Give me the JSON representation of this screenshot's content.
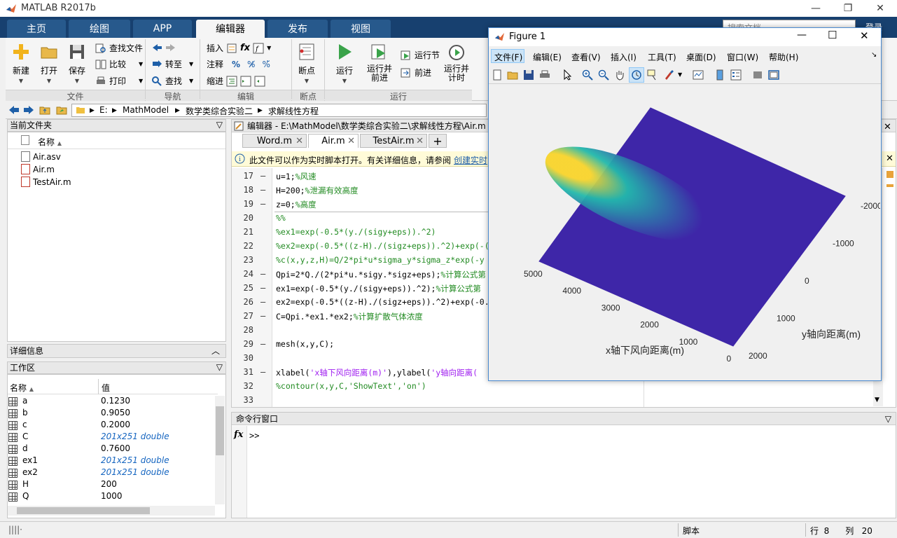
{
  "app": {
    "title": "MATLAB R2017b"
  },
  "ribbon_tabs": [
    "主页",
    "绘图",
    "APP",
    "编辑器",
    "发布",
    "视图"
  ],
  "ribbon": {
    "new": "新建",
    "open": "打开",
    "save": "保存",
    "find_files": "查找文件",
    "compare": "比较",
    "print": "打印",
    "goto": "转至",
    "find": "查找",
    "insert": "插入",
    "comment": "注释",
    "indent": "缩进",
    "breakpoints": "断点",
    "run": "运行",
    "run_advance": "运行并\n前进",
    "run_section": "运行节",
    "advance": "前进",
    "run_time": "运行并\n计时",
    "groups": {
      "file": "文件",
      "navigate": "导航",
      "edit": "编辑",
      "breakpoints": "断点",
      "run": "运行"
    }
  },
  "search": {
    "placeholder": "搜索文档",
    "user": "登录"
  },
  "address": {
    "drive": "E:",
    "p1": "MathModel",
    "p2": "数学类综合实验二",
    "p3": "求解线性方程"
  },
  "current_folder": {
    "title": "当前文件夹",
    "column": "名称",
    "files": [
      "Air.asv",
      "Air.m",
      "TestAir.m"
    ]
  },
  "details": {
    "title": "详细信息"
  },
  "workspace": {
    "title": "工作区",
    "col_name": "名称",
    "col_value": "值",
    "rows": [
      {
        "name": "a",
        "value": "0.1230",
        "link": false
      },
      {
        "name": "b",
        "value": "0.9050",
        "link": false
      },
      {
        "name": "c",
        "value": "0.2000",
        "link": false
      },
      {
        "name": "C",
        "value": "201x251 double",
        "link": true
      },
      {
        "name": "d",
        "value": "0.7600",
        "link": false
      },
      {
        "name": "ex1",
        "value": "201x251 double",
        "link": true
      },
      {
        "name": "ex2",
        "value": "201x251 double",
        "link": true
      },
      {
        "name": "H",
        "value": "200",
        "link": false
      },
      {
        "name": "Q",
        "value": "1000",
        "link": false
      }
    ]
  },
  "editor": {
    "title": "编辑器 - E:\\MathModel\\数学类综合实验二\\求解线性方程\\Air.m",
    "tabs": [
      "Word.m",
      "Air.m",
      "TestAir.m"
    ],
    "info": "此文件可以作为实时脚本打开。有关详细信息，请参阅",
    "info_link": "创建实时",
    "lines": [
      {
        "n": "17",
        "dash": "—",
        "code": "u=1;",
        "comment": "%风速"
      },
      {
        "n": "18",
        "dash": "—",
        "code": "H=200;",
        "comment": "%泄漏有效高度"
      },
      {
        "n": "19",
        "dash": "—",
        "code": "z=0;",
        "comment": "%高度"
      },
      {
        "n": "20",
        "dash": "",
        "code": "",
        "comment": "%%"
      },
      {
        "n": "21",
        "dash": "",
        "code": "",
        "comment": "%ex1=exp(-0.5*(y./(sigy+eps)).^2)"
      },
      {
        "n": "22",
        "dash": "",
        "code": "",
        "comment": "%ex2=exp(-0.5*((z-H)./(sigz+eps)).^2)+exp(-("
      },
      {
        "n": "23",
        "dash": "",
        "code": "",
        "comment": "%c(x,y,z,H)=Q/2*pi*u*sigma_y*sigma_z*exp(-y"
      },
      {
        "n": "24",
        "dash": "—",
        "code": "Qpi=2*Q./(2*pi*u.*sigy.*sigz+eps);",
        "comment": "%计算公式第"
      },
      {
        "n": "25",
        "dash": "—",
        "code": "ex1=exp(-0.5*(y./(sigy+eps)).^2);",
        "comment": "%计算公式第"
      },
      {
        "n": "26",
        "dash": "—",
        "code": "ex2=exp(-0.5*((z-H)./(sigz+eps)).^2)+exp(-0.",
        "comment": ""
      },
      {
        "n": "27",
        "dash": "—",
        "code": "C=Qpi.*ex1.*ex2;",
        "comment": "%计算扩散气体浓度"
      },
      {
        "n": "28",
        "dash": "",
        "code": "",
        "comment": ""
      },
      {
        "n": "29",
        "dash": "—",
        "code": "mesh(x,y,C);",
        "comment": ""
      },
      {
        "n": "30",
        "dash": "",
        "code": "",
        "comment": ""
      },
      {
        "n": "31",
        "dash": "—",
        "code": "xlabel(",
        "str1": "'x轴下风向距离(m)'",
        "mid": "),ylabel(",
        "str2": "'y轴向距离(",
        "comment": ""
      },
      {
        "n": "32",
        "dash": "",
        "code": "",
        "comment": "%contour(x,y,C,'ShowText','on')"
      },
      {
        "n": "33",
        "dash": "",
        "code": "",
        "comment": ""
      }
    ]
  },
  "command_window": {
    "title": "命令行窗口",
    "prompt": ">>",
    "fx": "fx"
  },
  "status": {
    "type": "脚本",
    "row_label": "行",
    "row": "8",
    "col_label": "列",
    "col": "20"
  },
  "figure": {
    "title": "Figure 1",
    "menus": [
      "文件(F)",
      "编辑(E)",
      "查看(V)",
      "插入(I)",
      "工具(T)",
      "桌面(D)",
      "窗口(W)",
      "帮助(H)"
    ],
    "xlabel": "x轴下风向距离(m)",
    "ylabel": "y轴向距离(m)",
    "x_ticks": [
      "0",
      "1000",
      "2000",
      "3000",
      "4000",
      "5000"
    ],
    "y_ticks": [
      "2000",
      "1000",
      "0",
      "-1000",
      "-2000"
    ]
  },
  "chart_data": {
    "type": "surface",
    "x_range": [
      0,
      5000
    ],
    "y_range": [
      -2000,
      2000
    ],
    "x_ticks": [
      0,
      1000,
      2000,
      3000,
      4000,
      5000
    ],
    "y_ticks": [
      2000,
      1000,
      0,
      -1000,
      -2000
    ],
    "xlabel": "x轴下风向距离(m)",
    "ylabel": "y轴向距离(m)",
    "colormap": "parula",
    "colors": {
      "low": "#3e26a8",
      "mid": "#22b9ac",
      "high": "#f9d42b"
    },
    "view": "3D"
  }
}
